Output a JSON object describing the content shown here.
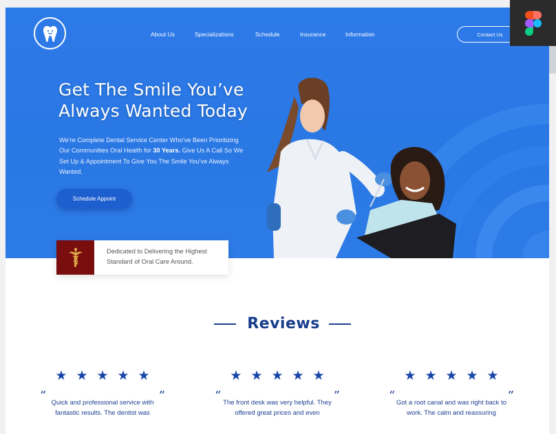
{
  "nav": {
    "items": [
      "About Us",
      "Specializations",
      "Schedule",
      "Insurance",
      "Information"
    ],
    "contact_label": "Contact Us"
  },
  "hero": {
    "title_line1": "Get The Smile You’ve",
    "title_line2": "Always Wanted Today",
    "desc_part1": "We’re Complete Dental Service Center Who’ve Been Prioritizing Our Communities Oral Health for ",
    "desc_bold": "30 Years.",
    "desc_part2": " Give Us A Call So We Set Up & Appointment To Give You The Smile You’ve Always Wanted.",
    "schedule_label": "Schedule Appoint"
  },
  "badge": {
    "text": "Dedicated to Delivering the Highest Standard of Oral Care Around."
  },
  "reviews": {
    "title": "Reviews",
    "stars": "★★★★★",
    "open_quote": "“",
    "close_quote": "”",
    "items": [
      {
        "rating": 5,
        "text": "Quick and professional service with fantastic results. The dentist was"
      },
      {
        "rating": 5,
        "text": "The front desk was very helpful. They offered great prices and even"
      },
      {
        "rating": 5,
        "text": "Got a root canal and was right back to work. The calm and reassuring"
      }
    ]
  },
  "colors": {
    "hero_blue": "#2a78e4",
    "button_blue": "#1e5fcf",
    "heading_navy": "#173c8c",
    "star_blue": "#1745a8",
    "badge_red": "#7a0e0e"
  },
  "icons": {
    "logo": "tooth-icon",
    "badge": "caduceus-icon",
    "app": "figma-icon"
  }
}
